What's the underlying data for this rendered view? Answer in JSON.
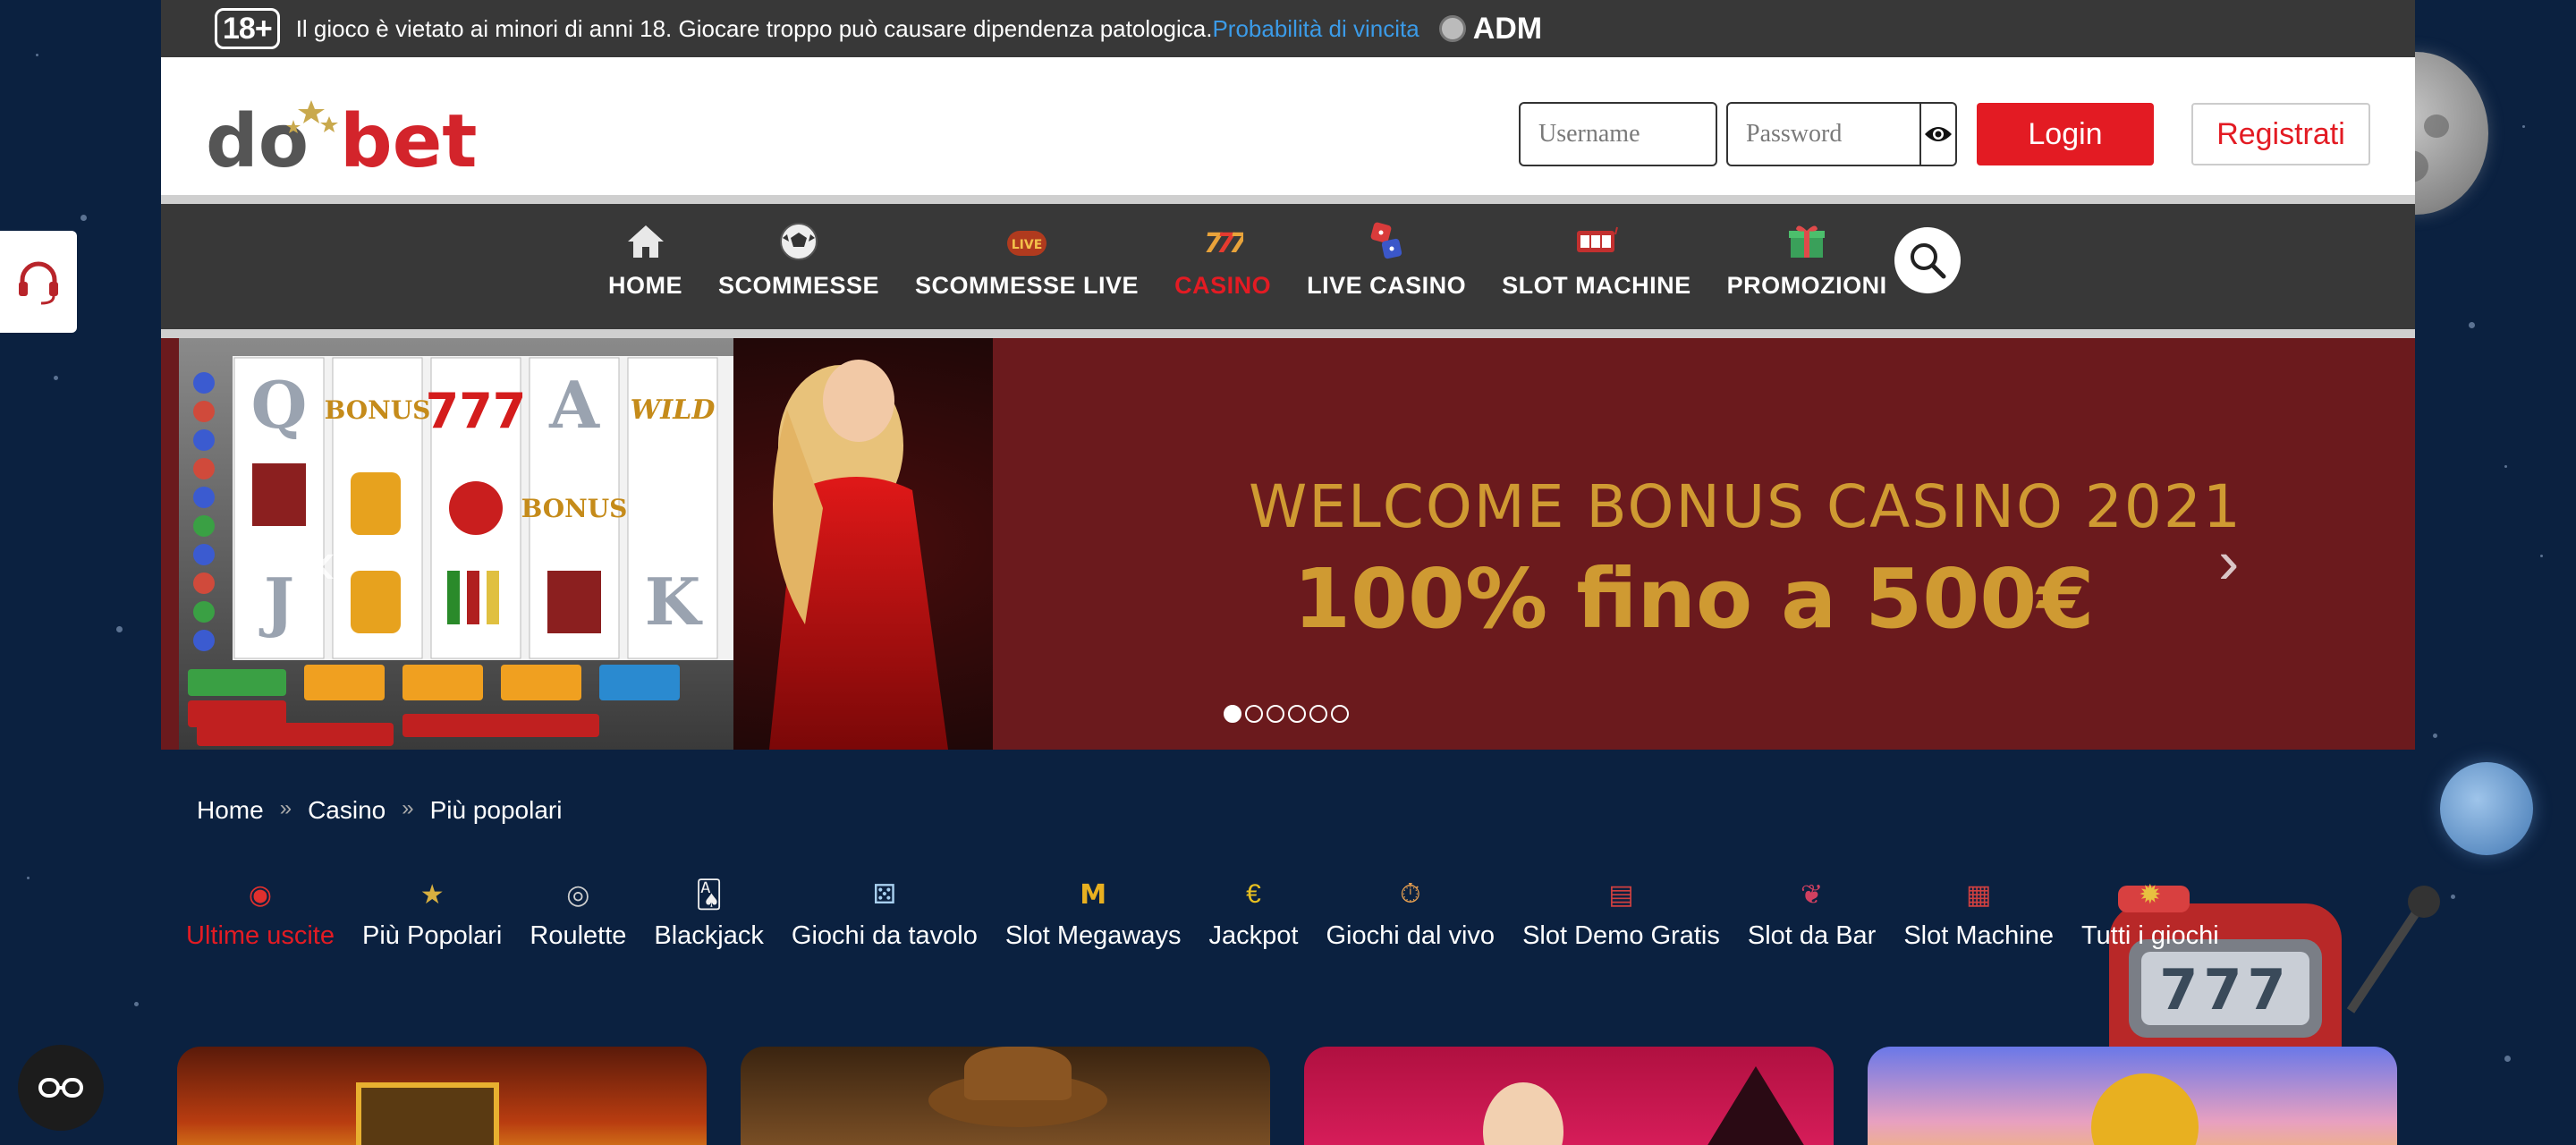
{
  "topbar": {
    "age_badge": "18+",
    "disclaimer": "Il gioco è vietato ai minori di anni 18. Giocare troppo può causare dipendenza patologica.",
    "probability_link": "Probabilità di vincita",
    "adm_label": "ADM"
  },
  "header": {
    "logo_text_left": "do",
    "logo_text_right": "bet",
    "username_placeholder": "Username",
    "password_placeholder": "Password",
    "login_label": "Login",
    "register_label": "Registrati"
  },
  "nav": {
    "items": [
      {
        "label": "HOME",
        "icon": "home-icon"
      },
      {
        "label": "SCOMMESSE",
        "icon": "soccer-ball-icon"
      },
      {
        "label": "SCOMMESSE LIVE",
        "icon": "live-icon"
      },
      {
        "label": "CASINO",
        "icon": "casino-777-icon",
        "active": true
      },
      {
        "label": "LIVE CASINO",
        "icon": "dice-icon"
      },
      {
        "label": "SLOT MACHINE",
        "icon": "slot-icon"
      },
      {
        "label": "PROMOZIONI",
        "icon": "gift-icon"
      }
    ]
  },
  "banner": {
    "title": "WELCOME BONUS CASINO 2021",
    "offer": "100% fino a 500€",
    "slide_count": 6,
    "active_slide": 1
  },
  "breadcrumb": [
    "Home",
    "Casino",
    "Più popolari"
  ],
  "categories": [
    {
      "label": "Ultime uscite",
      "icon": "new-icon",
      "active": true
    },
    {
      "label": "Più Popolari",
      "icon": "star-icon"
    },
    {
      "label": "Roulette",
      "icon": "roulette-icon"
    },
    {
      "label": "Blackjack",
      "icon": "cards-icon"
    },
    {
      "label": "Giochi da tavolo",
      "icon": "dice-icon"
    },
    {
      "label": "Slot Megaways",
      "icon": "megaways-icon"
    },
    {
      "label": "Jackpot",
      "icon": "euro-icon"
    },
    {
      "label": "Giochi dal vivo",
      "icon": "stopwatch-icon"
    },
    {
      "label": "Slot Demo Gratis",
      "icon": "slot-icon"
    },
    {
      "label": "Slot da Bar",
      "icon": "cherry-icon"
    },
    {
      "label": "Slot Machine",
      "icon": "slot-machine-icon"
    },
    {
      "label": "Tutti i giochi",
      "icon": "sun-icon"
    }
  ],
  "colors": {
    "brand_red": "#e31b23",
    "bar_dark": "#383838",
    "banner_bg": "#6b1a1d",
    "banner_text": "#cf9a32",
    "page_bg": "#0b2140",
    "link_blue": "#3b9be8"
  }
}
